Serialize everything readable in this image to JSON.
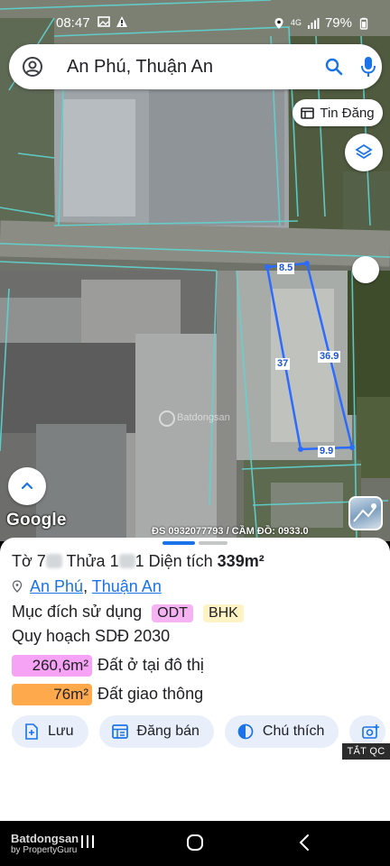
{
  "status_bar": {
    "time": "08:47",
    "battery": "79%",
    "network": "4G"
  },
  "search": {
    "query": "An Phú, Thuận An",
    "account_icon": "account-circle-icon",
    "search_icon": "search-icon",
    "mic_icon": "mic-icon"
  },
  "map": {
    "tin_dang_label": "Tin Đăng",
    "dim_top": "8.5",
    "dim_left": "37",
    "dim_right": "36.9",
    "dim_bottom": "9.9",
    "google_logo": "Google",
    "watermark": "ĐS 0932077793 / CẦM ĐỒ: 0933.0",
    "bds_watermark": "Batdongsan"
  },
  "sheet": {
    "to_label": "Tờ 7",
    "thua_label": "Thửa 1",
    "thua_tail": "1",
    "dien_tich_label": "Diện tích",
    "dien_tich_value": "339m²",
    "location_ward": "An Phú",
    "location_sep": ",",
    "location_city": "Thuận An",
    "muc_dich_label": "Mục đích sử dụng",
    "tag1": "ODT",
    "tag2": "BHK",
    "tag1_color": "#f5b3f2",
    "tag2_color": "#fdf3c4",
    "quy_hoach": "Quy hoạch SDĐ 2030",
    "zones": [
      {
        "area": "260,6m²",
        "label": "Đất ở tại đô thị",
        "color": "#f7a3f5"
      },
      {
        "area": "76m²",
        "label": "Đất giao thông",
        "color": "#ffa94d"
      }
    ],
    "actions": [
      {
        "label": "Lưu",
        "icon": "save-icon"
      },
      {
        "label": "Đăng bán",
        "icon": "listing-icon"
      },
      {
        "label": "Chú thích",
        "icon": "legend-icon"
      }
    ],
    "tat_qc": "TẮT QC"
  },
  "navbar": {
    "logo": "Batdongsan",
    "logo_sub": "by PropertyGuru"
  }
}
